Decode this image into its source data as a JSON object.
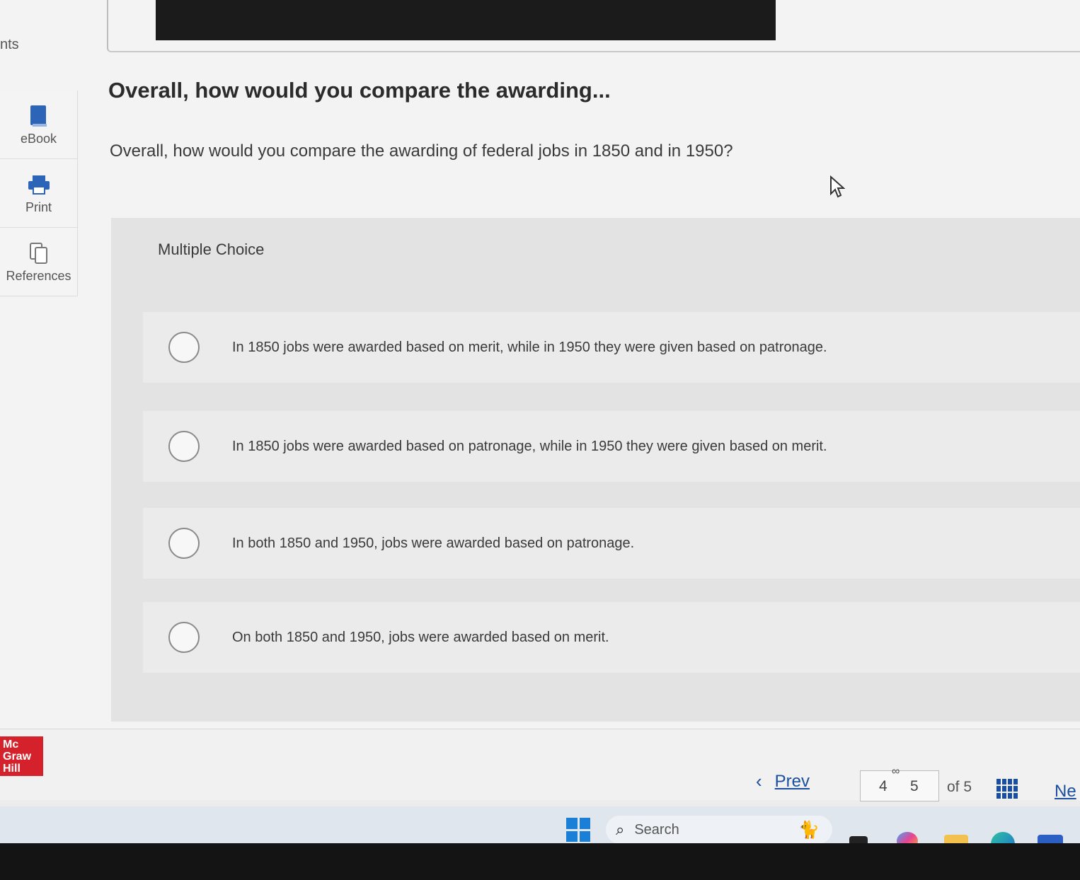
{
  "header": {
    "points_fragment": "nts"
  },
  "sidebar": {
    "items": [
      {
        "label": "eBook",
        "icon": "ebook-icon"
      },
      {
        "label": "Print",
        "icon": "print-icon"
      },
      {
        "label": "References",
        "icon": "references-icon"
      }
    ]
  },
  "question": {
    "title": "Overall, how would you compare the awarding...",
    "text": "Overall, how would you compare the awarding of federal jobs in 1850 and in 1950?",
    "type_label": "Multiple Choice",
    "options": [
      "In 1850 jobs were awarded based on merit, while in 1950 they were given based on patronage.",
      "In 1850 jobs were awarded based on patronage, while in 1950 they were given based on merit.",
      "In both 1850 and 1950, jobs were awarded based on patronage.",
      "On both 1850 and 1950, jobs were awarded based on merit."
    ]
  },
  "footer": {
    "logo": [
      "Mc",
      "Graw",
      "Hill"
    ],
    "prev_label": "Prev",
    "page_prev": "4",
    "page_current": "5",
    "of_total": "of 5",
    "next_label": "Ne"
  },
  "taskbar": {
    "search_label": "Search",
    "icons": [
      "windows-start-icon",
      "search-icon",
      "task-view-icon",
      "copilot-icon",
      "file-explorer-icon",
      "edge-icon",
      "word-icon"
    ]
  },
  "colors": {
    "accent": "#1a4fa0",
    "brand": "#d4212b",
    "windows_blue": "#1a7fd6"
  }
}
